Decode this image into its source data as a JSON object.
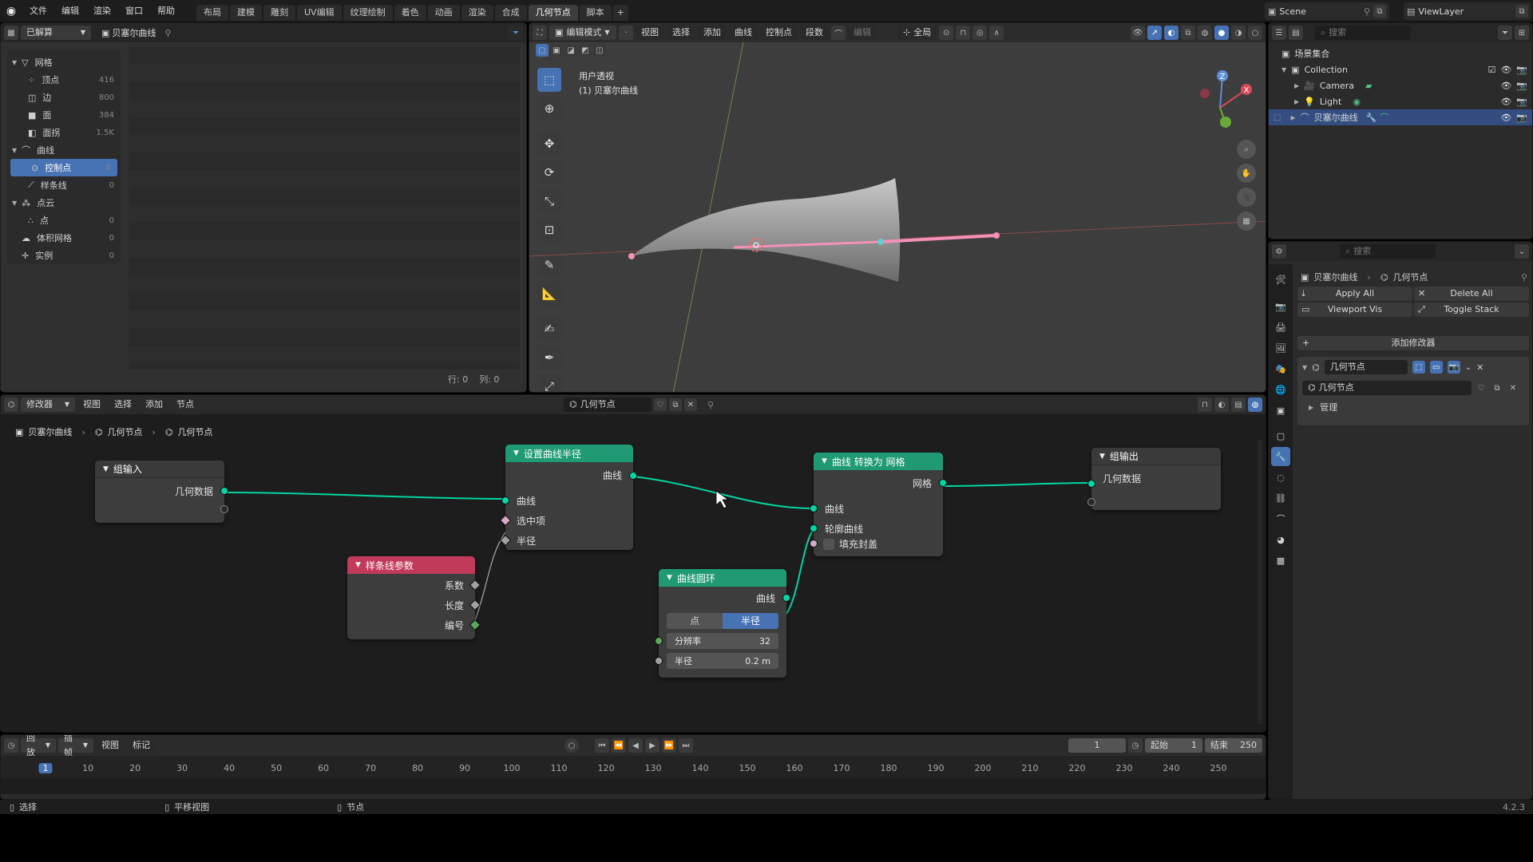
{
  "app": {
    "version": "4.2.3"
  },
  "topbar": {
    "menus": [
      "文件",
      "编辑",
      "渲染",
      "窗口",
      "帮助"
    ],
    "workspaces": [
      "布局",
      "建模",
      "雕刻",
      "UV编辑",
      "纹理绘制",
      "着色",
      "动画",
      "渲染",
      "合成",
      "几何节点",
      "脚本"
    ],
    "active_workspace": "几何节点",
    "add_tab": "+",
    "scene": "Scene",
    "view_layer": "ViewLayer"
  },
  "spreadsheet": {
    "mode": "已解算",
    "object": "贝塞尔曲线",
    "tree": [
      {
        "label": "网格",
        "value": "",
        "indent": 0,
        "group": true
      },
      {
        "label": "顶点",
        "value": "416",
        "indent": 1
      },
      {
        "label": "边",
        "value": "800",
        "indent": 1
      },
      {
        "label": "面",
        "value": "384",
        "indent": 1
      },
      {
        "label": "面拐",
        "value": "1.5K",
        "indent": 1
      },
      {
        "label": "曲线",
        "value": "",
        "indent": 0,
        "group": true
      },
      {
        "label": "控制点",
        "value": "0",
        "indent": 1,
        "selected": true
      },
      {
        "label": "样条线",
        "value": "0",
        "indent": 1
      },
      {
        "label": "点云",
        "value": "",
        "indent": 0,
        "group": true
      },
      {
        "label": "点",
        "value": "0",
        "indent": 1
      },
      {
        "label": "体积网格",
        "value": "0",
        "indent": 0
      },
      {
        "label": "实例",
        "value": "0",
        "indent": 0
      }
    ],
    "footer_rows": "行: 0",
    "footer_cols": "列: 0"
  },
  "viewport": {
    "mode": "编辑模式",
    "menus": [
      "视图",
      "选择",
      "添加",
      "曲线",
      "控制点",
      "段数"
    ],
    "edit_label": "编辑",
    "global": "全局",
    "overlay_title": "用户透视",
    "overlay_object": "(1) 贝塞尔曲线",
    "gizmo": {
      "z": "Z",
      "x": "X"
    }
  },
  "outliner": {
    "search_placeholder": "搜索",
    "root": "场景集合",
    "collection": "Collection",
    "items": [
      "Camera",
      "Light",
      "贝塞尔曲线"
    ],
    "selected": "贝塞尔曲线"
  },
  "properties": {
    "search_placeholder": "搜索",
    "breadcrumb_object": "贝塞尔曲线",
    "breadcrumb_modifier": "几何节点",
    "apply_all": "Apply All",
    "delete_all": "Delete All",
    "viewport_vis": "Viewport Vis",
    "toggle_stack": "Toggle Stack",
    "add_modifier": "添加修改器",
    "modifier_name": "几何节点",
    "node_group": "几何节点",
    "manage": "管理"
  },
  "node_editor": {
    "editor_type": "修改器",
    "menus": [
      "视图",
      "选择",
      "添加",
      "节点"
    ],
    "node_tree": "几何节点",
    "breadcrumb": [
      "贝塞尔曲线",
      "几何节点",
      "几何节点"
    ],
    "nodes": {
      "group_input": {
        "title": "组输入",
        "out_geometry": "几何数据"
      },
      "spline_params": {
        "title": "样条线参数",
        "factor": "系数",
        "length": "长度",
        "index": "编号"
      },
      "set_radius": {
        "title": "设置曲线半径",
        "out_curve": "曲线",
        "in_curve": "曲线",
        "selection": "选中项",
        "radius": "半径"
      },
      "curve_circle": {
        "title": "曲线圆环",
        "out_curve": "曲线",
        "mode_points": "点",
        "mode_radius": "半径",
        "resolution_label": "分辨率",
        "resolution_value": "32",
        "radius_label": "半径",
        "radius_value": "0.2 m"
      },
      "curve_to_mesh": {
        "title": "曲线 转换为 网格",
        "out_mesh": "网格",
        "curve": "曲线",
        "profile": "轮廓曲线",
        "fill_caps": "填充封盖"
      },
      "group_output": {
        "title": "组输出",
        "in_geometry": "几何数据"
      }
    }
  },
  "timeline": {
    "playback": "回放",
    "keying": "插帧",
    "view": "视图",
    "marker": "标记",
    "current_frame": "1",
    "start_label": "起始",
    "start": "1",
    "end_label": "结束",
    "end": "250",
    "ticks": [
      "1",
      "10",
      "20",
      "30",
      "40",
      "50",
      "60",
      "70",
      "80",
      "90",
      "100",
      "110",
      "120",
      "130",
      "140",
      "150",
      "160",
      "170",
      "180",
      "190",
      "200",
      "210",
      "220",
      "230",
      "240",
      "250"
    ]
  },
  "statusbar": {
    "select": "选择",
    "pan": "平移视图",
    "node": "节点",
    "version": "4.2.3"
  },
  "colors": {
    "accent_blue": "#4772b3",
    "geometry_socket": "#00d6a3",
    "spline_header": "#c23a5a",
    "geometry_header": "#1f9a75",
    "curve_pink": "#f391b8"
  }
}
